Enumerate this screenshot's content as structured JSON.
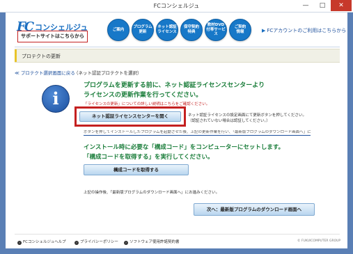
{
  "window": {
    "title": "FCコンシェルジュ",
    "min_label": "—",
    "max_label": "□",
    "close_label": "✕"
  },
  "header": {
    "logo_mark": "FC",
    "logo_name": "コンシェルジュ",
    "support_label": "サポートサイトはこちらから",
    "nav": [
      {
        "line1": "ご案内",
        "line2": ""
      },
      {
        "line1": "プログラム",
        "line2": "更新"
      },
      {
        "line1": "ネット認証",
        "line2": "ライセンス"
      },
      {
        "line1": "保守契約",
        "line2": "特典"
      },
      {
        "line1": "教材DVD",
        "line2": "付帯サービス"
      },
      {
        "line1": "ご契約",
        "line2": "情報"
      }
    ],
    "fc_account_arrow": "▶",
    "fc_account": "FCアカウントのご利用はこちらから"
  },
  "section": {
    "title": "プロテクトの更新"
  },
  "breadcrumb": {
    "back_link": "≪ プロテクト選択画面に戻る",
    "note": "（ネット認証プロテクトを選択）"
  },
  "info": {
    "icon_glyph": "i",
    "message1_line1": "プログラムを更新する前に、ネット認証ライセンスセンターより",
    "message1_line2": "ライセンスの更新作業を行ってください。",
    "license_link": "「ライセンスの更新」についての詳しい説明はこちらをご確認ください。",
    "auth_button": "ネット認証ライセンスセンターを開く",
    "auth_note_line1": "ネット認証ライセンスの設定画面にて更新ボタンを押してください。",
    "auth_note_line2": "（認証されていない場合は認証してください。）",
    "hidden_note": "ボタンを押してインストールしたプログラムを起動させた後、上記の更新作業を行い、「最新版プログラムのダウンロード画面へ」にお進みください。",
    "message2_line1": "インストール時に必要な「構成コード」をコンピューターにセットします。",
    "message2_line2": "「構成コードを取得する」を実行してください。",
    "cert_button": "構成コードを取得する",
    "after_note": "上記の操作後、「最新版プログラムのダウンロード画面へ」にお進みください。",
    "next_button": "次へ：最新版プログラムのダウンロード画面へ"
  },
  "footer": {
    "links": [
      {
        "label": "FCコンシェルジュヘルプ"
      },
      {
        "label": "プライバシーポリシー"
      },
      {
        "label": "ソフトウェア使用許諾契約書"
      }
    ],
    "dot_glyph": "›",
    "copyright": "© FUKUICOMPUTER GROUP"
  },
  "colors": {
    "frame": "#5a7fb5",
    "nav_blue": "#1778c8",
    "green_message": "#1a7d3a",
    "highlight_red": "#c42020"
  }
}
